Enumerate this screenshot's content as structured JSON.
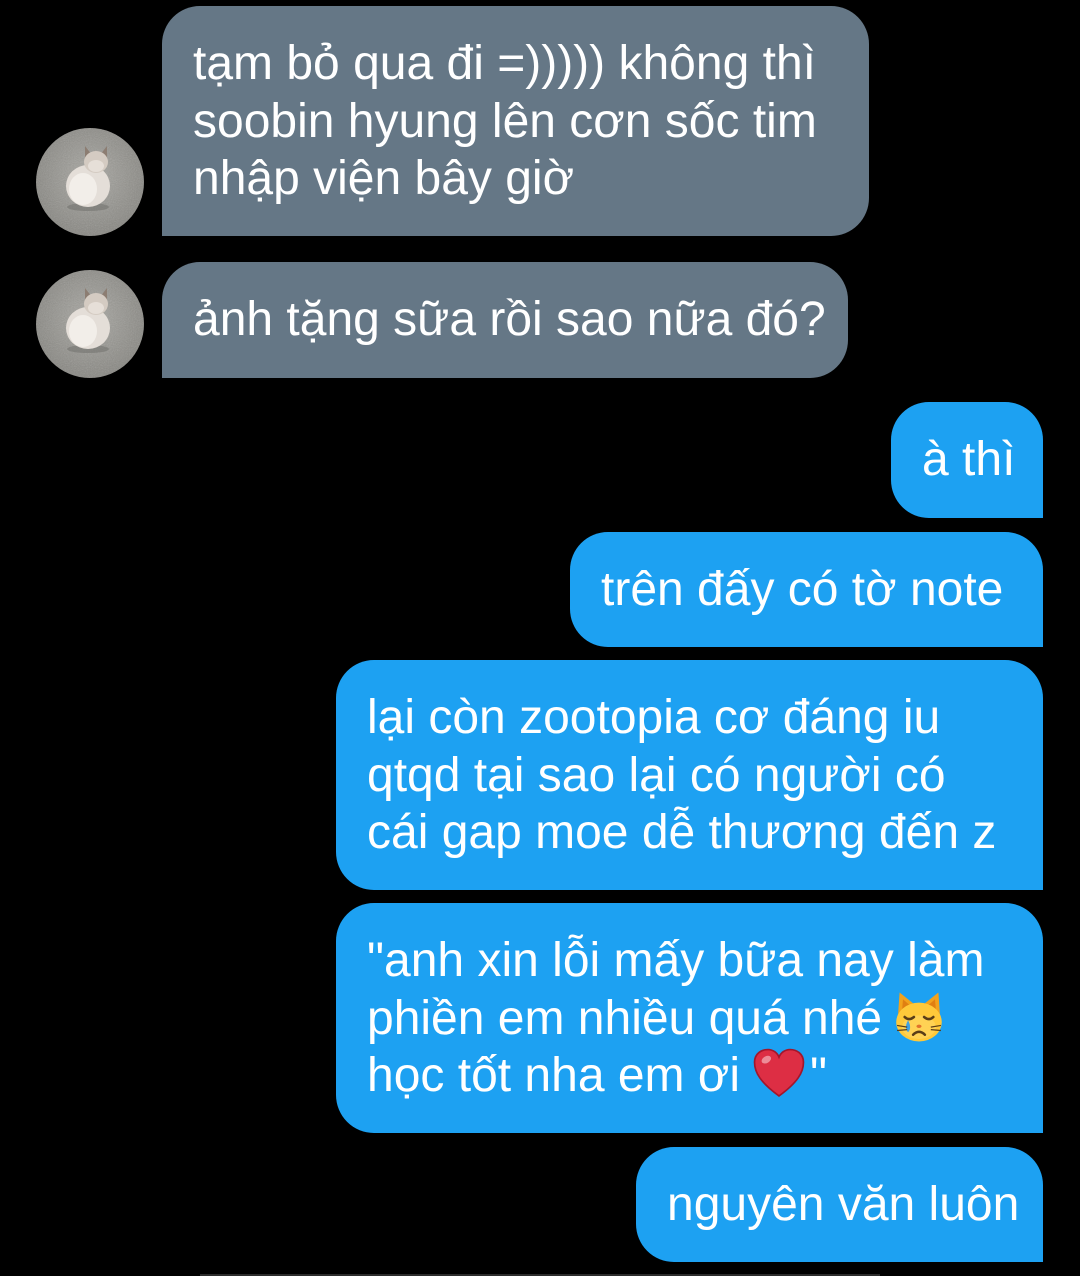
{
  "colors": {
    "background": "#000000",
    "received_bubble": "#657786",
    "sent_bubble": "#1da1f2",
    "message_text": "#ffffff"
  },
  "received": [
    {
      "avatar_icon": "cat-avatar",
      "lines": [
        "tạm bỏ qua đi =))))) không thì",
        "soobin hyung lên cơn sốc tim",
        "nhập viện bây giờ"
      ]
    },
    {
      "avatar_icon": "cat-avatar",
      "lines": [
        "ảnh tặng sữa rồi sao nữa đó?"
      ]
    }
  ],
  "sent": [
    {
      "lines": [
        "à thì"
      ]
    },
    {
      "lines": [
        "trên đấy có tờ note"
      ]
    },
    {
      "lines": [
        "lại còn zootopia cơ đáng iu",
        "qtqd tại sao lại có người có",
        "cái gap moe dễ thương đến z"
      ]
    },
    {
      "lines": [
        {
          "text": "\"anh xin lỗi mấy bữa nay làm"
        },
        {
          "text": "phiền em nhiều quá nhé",
          "emoji_icon": "crying-cat-face-icon"
        },
        {
          "text": "học tốt nha em ơi",
          "emoji_icon": "red-heart-icon",
          "text_after": "\""
        }
      ]
    },
    {
      "lines": [
        "nguyên văn luôn"
      ]
    }
  ]
}
